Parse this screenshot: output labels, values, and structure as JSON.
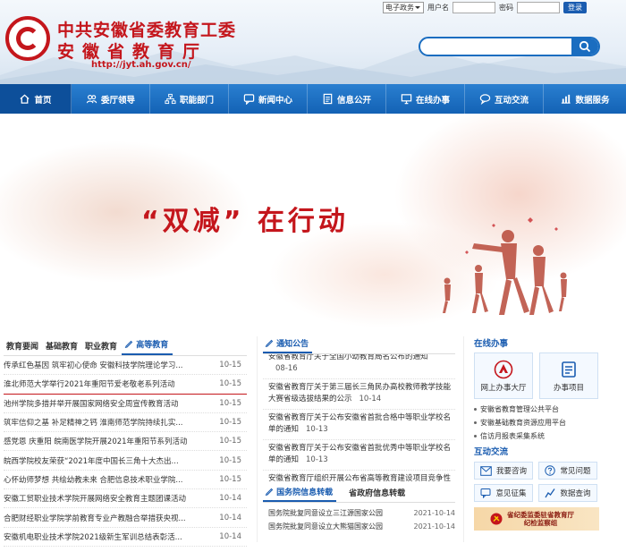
{
  "header": {
    "title_line1": "中共安徽省委教育工委",
    "title_line2": "安徽省教育厅",
    "url": "http://jyt.ah.gov.cn/",
    "login": {
      "select_value": "电子政务",
      "user_label": "用户名",
      "pwd_label": "密码",
      "login_button": "登录"
    },
    "search": {
      "placeholder": ""
    },
    "brand_color": "#c4161c"
  },
  "nav": [
    {
      "label": "首页",
      "icon": "home-icon"
    },
    {
      "label": "委厅领导",
      "icon": "people-icon"
    },
    {
      "label": "职能部门",
      "icon": "org-icon"
    },
    {
      "label": "新闻中心",
      "icon": "chat-icon"
    },
    {
      "label": "信息公开",
      "icon": "document-icon"
    },
    {
      "label": "在线办事",
      "icon": "screen-icon"
    },
    {
      "label": "互动交流",
      "icon": "bubble-icon"
    },
    {
      "label": "数据服务",
      "icon": "chart-icon"
    }
  ],
  "banner": {
    "slogan": "“双减” 在行动"
  },
  "news": {
    "tabs": [
      "教育要闻",
      "基础教育",
      "职业教育",
      "高等教育"
    ],
    "active_tab": 3,
    "items": [
      {
        "title": "传承红色基因 筑牢初心使命 安徽科技学院理论学习...",
        "date": "10-15"
      },
      {
        "title": "淮北师范大学举行2021年重阳节爱老敬老系列活动",
        "date": "10-15"
      },
      {
        "title": "池州学院多措并举开展国家网络安全周宣传教育活动",
        "date": "10-15"
      },
      {
        "title": "筑牢信仰之基 补足精神之钙 淮南师范学院持续扎实...",
        "date": "10-15"
      },
      {
        "title": "感党恩 庆重阳 皖南医学院开展2021年重阳节系列活动",
        "date": "10-15"
      },
      {
        "title": "皖西学院校友荣获“2021年度中国长三角十大杰出...",
        "date": "10-15"
      },
      {
        "title": "心怀幼师梦想 共绘幼教未来 合肥信息技术职业学院...",
        "date": "10-15"
      },
      {
        "title": "安徽工贸职业技术学院开展网络安全教育主题团课活动",
        "date": "10-14"
      },
      {
        "title": "合肥财经职业学院学前教育专业产教融合举措获央视...",
        "date": "10-14"
      },
      {
        "title": "安徽机电职业技术学院2021级新生军训总结表彰活...",
        "date": "10-14"
      }
    ]
  },
  "notice": {
    "title": "通知公告",
    "items": [
      {
        "title": "安徽省教育厅关于全国小幼教育局名公布的通知",
        "date": "08-16"
      },
      {
        "title": "安徽省教育厅关于第三届长三角民办高校教师教学技能大赛省级选拔结果的公示",
        "date": "10-14"
      },
      {
        "title": "安徽省教育厅关于公布安徽省首批合格中等职业学校名单的通知",
        "date": "10-13"
      },
      {
        "title": "安徽省教育厅关于公布安徽省首批优秀中等职业学校名单的通知",
        "date": "10-13"
      },
      {
        "title": "安徽省教育厅组织开展公布省高等教育建设项目竞争性磋商公告",
        "date": ""
      }
    ]
  },
  "gov": {
    "tab_active": "国务院信息转载",
    "tab_other": "省政府信息转载",
    "items": [
      {
        "title": "国务院批复同意设立三江源国家公园",
        "date": "2021-10-14"
      },
      {
        "title": "国务院批复同意设立大熊猫国家公园",
        "date": "2021-10-14"
      }
    ]
  },
  "online": {
    "title": "在线办事",
    "big_buttons": [
      {
        "label": "网上办事大厅",
        "icon": "hall-icon"
      },
      {
        "label": "办事项目",
        "icon": "list-icon"
      }
    ],
    "links": [
      "安徽省教育管理公共平台",
      "安徽基础教育资源应用平台",
      "信访月报表采集系统"
    ]
  },
  "interact": {
    "title": "互动交流",
    "buttons": [
      {
        "label": "我要咨询",
        "icon": "mail-icon"
      },
      {
        "label": "常见问题",
        "icon": "question-icon"
      },
      {
        "label": "意见征集",
        "icon": "comment-icon"
      },
      {
        "label": "数据查询",
        "icon": "query-icon"
      }
    ],
    "jiwei_line1": "省纪委监委驻省教育厅",
    "jiwei_line2": "纪检监察组"
  }
}
